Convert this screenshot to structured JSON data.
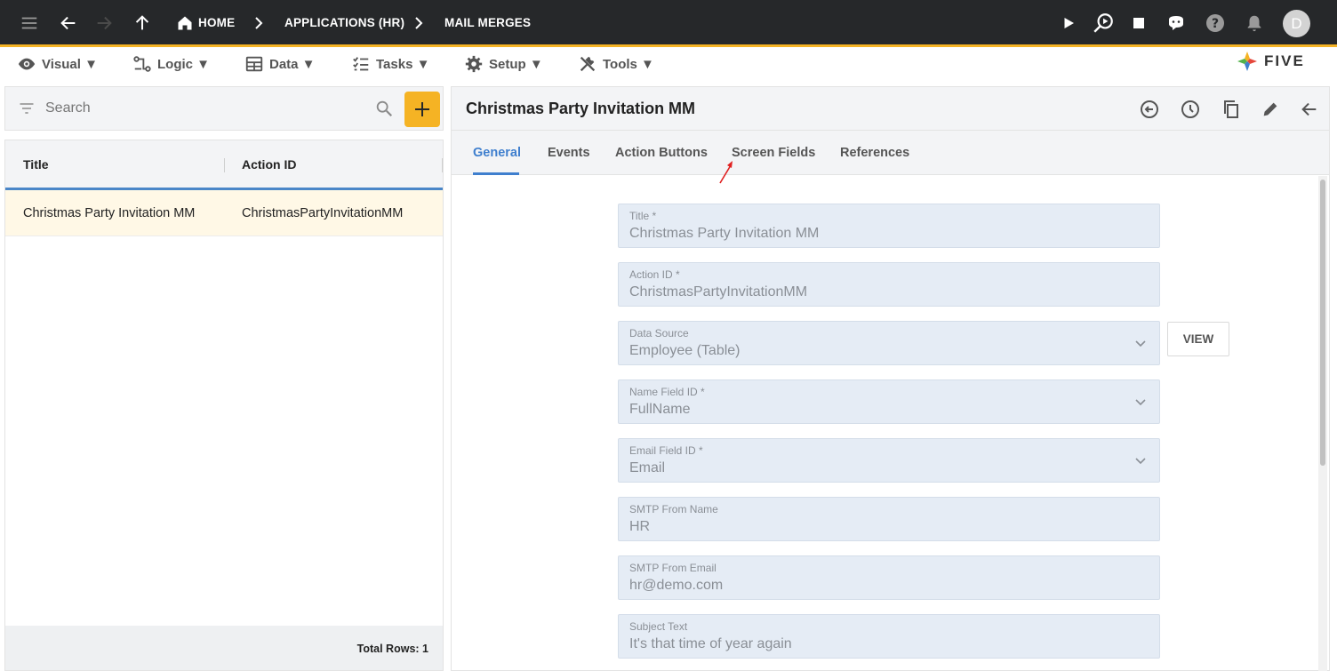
{
  "topbar": {
    "breadcrumbs": [
      "HOME",
      "APPLICATIONS (HR)",
      "MAIL MERGES"
    ],
    "avatar_letter": "D",
    "accent_color": "#f5b324",
    "icons": [
      "menu-icon",
      "back-arrow-icon",
      "forward-arrow-icon",
      "up-arrow-icon",
      "home-icon",
      "play-icon",
      "search-play-icon",
      "stop-icon",
      "chat-icon",
      "help-icon",
      "bell-icon"
    ]
  },
  "menubar": {
    "items": [
      "Visual ▼",
      "Logic ▼",
      "Data ▼",
      "Tasks ▼",
      "Setup ▼",
      "Tools ▼"
    ],
    "logo_text": "FIVE"
  },
  "left": {
    "search_placeholder": "Search",
    "columns": [
      "Title",
      "Action ID"
    ],
    "rows": [
      {
        "title": "Christmas Party Invitation MM",
        "action_id": "ChristmasPartyInvitationMM"
      }
    ],
    "total_rows": "Total Rows: 1"
  },
  "detail": {
    "title": "Christmas Party Invitation MM",
    "tabs": [
      "General",
      "Events",
      "Action Buttons",
      "Screen Fields",
      "References"
    ],
    "active_tab": "General",
    "fields": [
      {
        "label": "Title *",
        "value": "Christmas Party Invitation MM",
        "dropdown": false
      },
      {
        "label": "Action ID *",
        "value": "ChristmasPartyInvitationMM",
        "dropdown": false
      },
      {
        "label": "Data Source",
        "value": "Employee (Table)",
        "dropdown": true
      },
      {
        "label": "Name Field ID *",
        "value": "FullName",
        "dropdown": true
      },
      {
        "label": "Email Field ID *",
        "value": "Email",
        "dropdown": true
      },
      {
        "label": "SMTP From Name",
        "value": "HR",
        "dropdown": false
      },
      {
        "label": "SMTP From Email",
        "value": "hr@demo.com",
        "dropdown": false
      },
      {
        "label": "Subject Text",
        "value": "It's that time of year again",
        "dropdown": false
      }
    ],
    "view_button": "VIEW",
    "tab_accent": "#3f7fce"
  }
}
